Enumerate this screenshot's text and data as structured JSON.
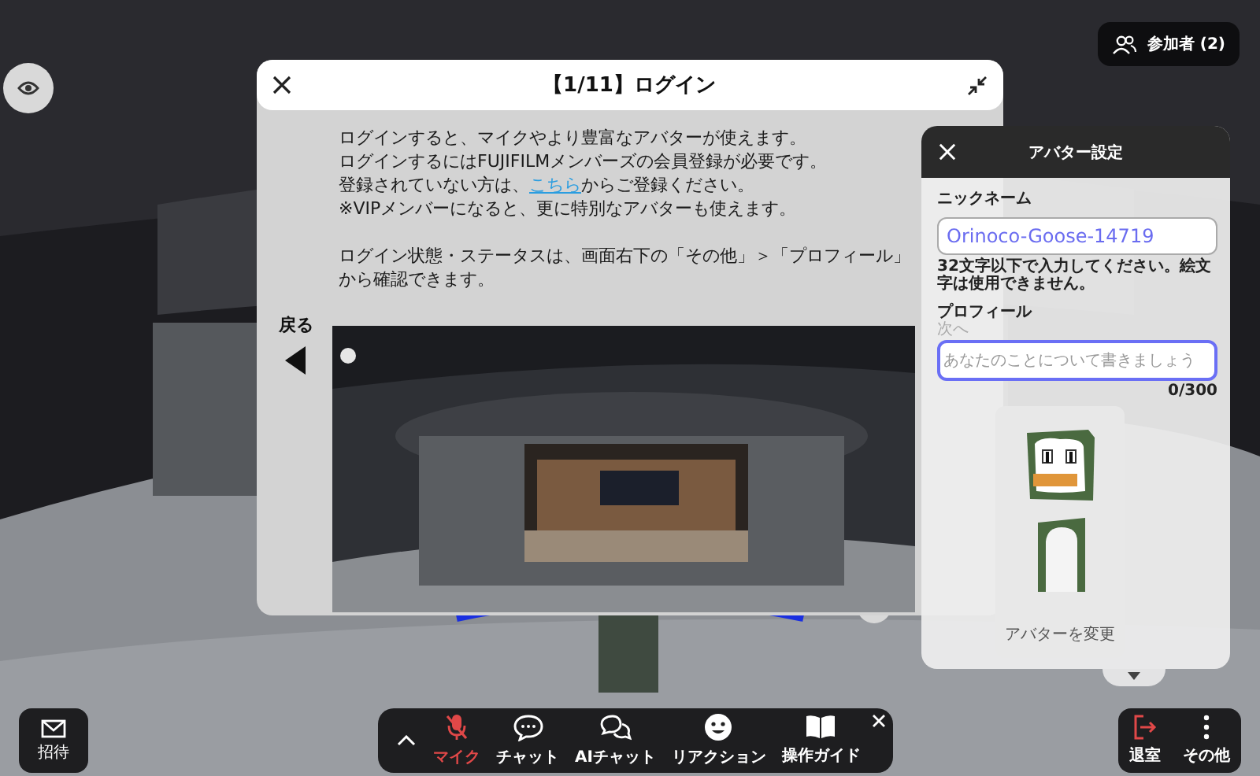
{
  "top_left": {
    "kind": "eye"
  },
  "participants": {
    "label": "参加者 (2)"
  },
  "modal": {
    "title": "【1/11】ログイン",
    "body": [
      {
        "kind": "text",
        "text": "ログインすると、マイクやより豊富なアバターが使えます。"
      },
      {
        "kind": "text",
        "text": "ログインするにはFUJIFILMメンバーズの会員登録が必要です。"
      },
      {
        "kind": "link_line",
        "before": "登録されていない方は、",
        "link": "こちら",
        "after": "からご登録ください。"
      },
      {
        "kind": "text",
        "text": "※VIPメンバーになると、更に特別なアバターも使えます。"
      },
      {
        "kind": "gap"
      },
      {
        "kind": "text",
        "text": "ログイン状態・ステータスは、画面右下の「その他」＞「プロフィール」"
      },
      {
        "kind": "text",
        "text": "から確認できます。"
      }
    ],
    "back_label": "戻る"
  },
  "avatar_panel": {
    "title": "アバター設定",
    "nickname_label": "ニックネーム",
    "nickname_value": "Orinoco-Goose-14719",
    "nickname_hint": "32文字以下で入力してください。絵文字は使用できません。",
    "profile_label": "プロフィール",
    "next_hint": "次へ",
    "profile_placeholder": "あなたのことについて書きましょう",
    "profile_focused": true,
    "counter": "0/300",
    "change_avatar": "アバターを変更"
  },
  "invite": {
    "label": "招待"
  },
  "toolbar": [
    {
      "kind": "mic",
      "label": "マイク",
      "muted": true
    },
    {
      "kind": "chat",
      "label": "チャット"
    },
    {
      "kind": "aichat",
      "label": "AIチャット"
    },
    {
      "kind": "reaction",
      "label": "リアクション"
    },
    {
      "kind": "guide",
      "label": "操作ガイド"
    }
  ],
  "right_buttons": [
    {
      "kind": "exit",
      "label": "退室"
    },
    {
      "kind": "more",
      "label": "その他"
    }
  ]
}
